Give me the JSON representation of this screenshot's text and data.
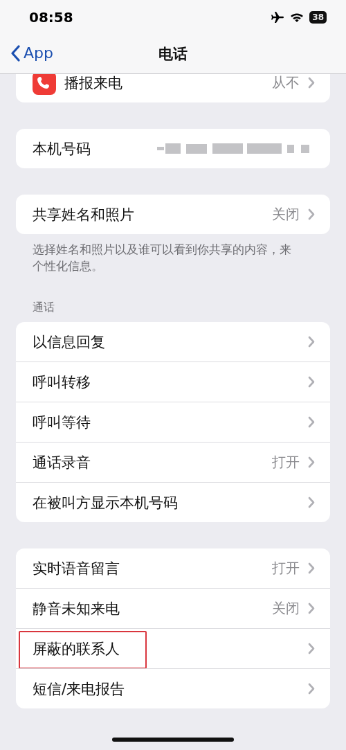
{
  "status_bar": {
    "time": "08:58",
    "airplane_mode": true,
    "battery": "38"
  },
  "nav": {
    "back": "App",
    "title": "电话"
  },
  "groups": [
    {
      "rows": [
        {
          "kind": "app",
          "label": "播报来电",
          "value": "从不"
        }
      ]
    },
    {
      "rows": [
        {
          "kind": "masked",
          "label": "本机号码"
        }
      ]
    },
    {
      "rows": [
        {
          "kind": "link",
          "label": "共享姓名和照片",
          "value": "关闭"
        }
      ],
      "footer": "选择姓名和照片以及谁可以看到你共享的内容，来个性化信息。"
    },
    {
      "header": "通话",
      "rows": [
        {
          "kind": "link",
          "label": "以信息回复"
        },
        {
          "kind": "link",
          "label": "呼叫转移"
        },
        {
          "kind": "link",
          "label": "呼叫等待"
        },
        {
          "kind": "link",
          "label": "通话录音",
          "value": "打开"
        },
        {
          "kind": "link",
          "label": "在被叫方显示本机号码"
        }
      ]
    },
    {
      "rows": [
        {
          "kind": "link",
          "label": "实时语音留言",
          "value": "打开"
        },
        {
          "kind": "link",
          "label": "静音未知来电",
          "value": "关闭"
        },
        {
          "kind": "link",
          "label": "屏蔽的联系人",
          "highlighted": true
        },
        {
          "kind": "link",
          "label": "短信/来电报告"
        }
      ]
    }
  ]
}
